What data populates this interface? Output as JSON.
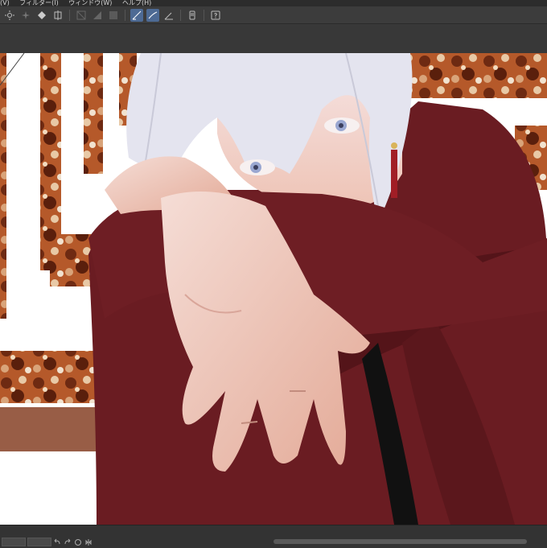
{
  "menu": {
    "items": [
      "(V)",
      "フィルター(I)",
      "ウィンドウ(W)",
      "ヘルプ(H)"
    ]
  },
  "toolbar": {
    "icons": [
      "sun-icon",
      "sparkle-icon",
      "diamond-icon",
      "transform-icon",
      "grid-icon-1",
      "grid-icon-2",
      "square-icon",
      "ruler-snap-icon",
      "ruler-snap-icon-2",
      "ruler-angle-icon",
      "device-icon",
      "help-icon"
    ]
  },
  "colors": {
    "accent": "#4d6a94",
    "jacket": "#6a1c22",
    "rust": "#8b3a17",
    "skin": "#f1d1c7",
    "hair": "#e4e4ef"
  }
}
